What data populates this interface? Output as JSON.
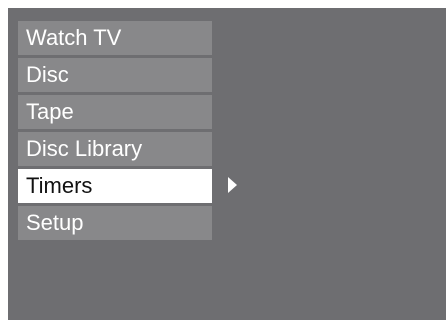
{
  "menu": {
    "items": [
      {
        "label": "Watch TV",
        "selected": false
      },
      {
        "label": "Disc",
        "selected": false
      },
      {
        "label": "Tape",
        "selected": false
      },
      {
        "label": "Disc Library",
        "selected": false
      },
      {
        "label": "Timers",
        "selected": true
      },
      {
        "label": "Setup",
        "selected": false
      }
    ],
    "submenu_indicator_icon": "triangle-right-icon"
  },
  "colors": {
    "screen_background": "#6e6e71",
    "item_background": "#88888a",
    "item_text": "#ffffff",
    "selected_background": "#ffffff",
    "selected_text": "#111111"
  }
}
